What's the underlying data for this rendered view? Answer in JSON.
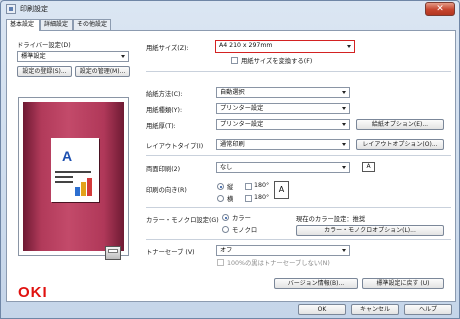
{
  "window": {
    "title": "印刷設定",
    "close_glyph": "✕"
  },
  "tabs": [
    {
      "label": "基本設定",
      "active": true
    },
    {
      "label": "詳細設定",
      "active": false
    },
    {
      "label": "その他設定",
      "active": false
    }
  ],
  "driver": {
    "label": "ドライバー設定(D)",
    "value": "標準設定",
    "register_button": "設定の登録(S)...",
    "manage_button": "設定の管理(M)..."
  },
  "paper": {
    "size_label": "用紙サイズ(Z):",
    "size_value": "A4 210 x 297mm",
    "convert_checkbox": "用紙サイズを変換する(F)",
    "convert_checked": false
  },
  "feed": {
    "method_label": "給紙方法(C):",
    "method_value": "自動選択",
    "type_label": "用紙種類(Y):",
    "type_value": "プリンター設定",
    "weight_label": "用紙厚(T):",
    "weight_value": "プリンター設定",
    "options_button": "給紙オプション(E)..."
  },
  "layout": {
    "label": "レイアウトタイプ(I)",
    "value": "通常印刷",
    "options_button": "レイアウトオプション(O)..."
  },
  "duplex": {
    "label": "両面印刷(2)",
    "value": "なし",
    "glyph": "A"
  },
  "orientation": {
    "label": "印刷の向き(R)",
    "portrait": "縦",
    "landscape": "横",
    "rotate_label": "180°",
    "selected": "portrait",
    "glyph": "A"
  },
  "color": {
    "label": "カラー・モノクロ設定(G)",
    "color_option": "カラー",
    "mono_option": "モノクロ",
    "selected": "color",
    "current_label": "現在のカラー設定：推奨",
    "options_button": "カラー・モノクロオプション(L)..."
  },
  "toner": {
    "label": "トナーセーブ (V)",
    "value": "オフ",
    "black_100_checkbox": "100%の黒はトナーセーブしない(N)",
    "black_100_enabled": false
  },
  "brand": {
    "logo_text": "OKI",
    "logo_color": "#e0110f"
  },
  "buttons": {
    "version": "バージョン情報(B)...",
    "restore": "標準設定に戻す (U)",
    "ok": "OK",
    "cancel": "キャンセル",
    "help": "ヘルプ"
  },
  "colors": {
    "highlight_border": "#d32222",
    "accent_blue": "#1c4fb0",
    "preview_bg": "#b13a5a"
  }
}
